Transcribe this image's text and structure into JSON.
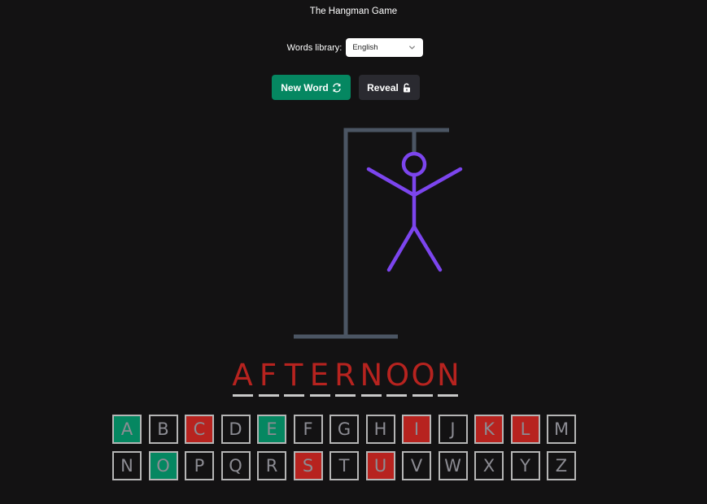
{
  "app": {
    "title": "The Hangman Game"
  },
  "library": {
    "label": "Words library:",
    "selected": "English"
  },
  "buttons": {
    "new_word": "New Word",
    "reveal": "Reveal"
  },
  "colors": {
    "background": "#131213",
    "correct": "#058761",
    "wrong": "#b7231f",
    "gallows": "#4b5563",
    "figure": "#7c45ee",
    "revealed_letter": "#b7231f"
  },
  "word": {
    "letters": [
      "A",
      "F",
      "T",
      "E",
      "R",
      "N",
      "O",
      "O",
      "N"
    ]
  },
  "keyboard": {
    "rows": [
      [
        {
          "letter": "A",
          "state": "correct"
        },
        {
          "letter": "B",
          "state": "unused"
        },
        {
          "letter": "C",
          "state": "wrong"
        },
        {
          "letter": "D",
          "state": "unused"
        },
        {
          "letter": "E",
          "state": "correct"
        },
        {
          "letter": "F",
          "state": "unused"
        },
        {
          "letter": "G",
          "state": "unused"
        },
        {
          "letter": "H",
          "state": "unused"
        },
        {
          "letter": "I",
          "state": "wrong"
        },
        {
          "letter": "J",
          "state": "unused"
        },
        {
          "letter": "K",
          "state": "wrong"
        },
        {
          "letter": "L",
          "state": "wrong"
        },
        {
          "letter": "M",
          "state": "unused"
        }
      ],
      [
        {
          "letter": "N",
          "state": "unused"
        },
        {
          "letter": "O",
          "state": "correct"
        },
        {
          "letter": "P",
          "state": "unused"
        },
        {
          "letter": "Q",
          "state": "unused"
        },
        {
          "letter": "R",
          "state": "unused"
        },
        {
          "letter": "S",
          "state": "wrong"
        },
        {
          "letter": "T",
          "state": "unused"
        },
        {
          "letter": "U",
          "state": "wrong"
        },
        {
          "letter": "V",
          "state": "unused"
        },
        {
          "letter": "W",
          "state": "unused"
        },
        {
          "letter": "X",
          "state": "unused"
        },
        {
          "letter": "Y",
          "state": "unused"
        },
        {
          "letter": "Z",
          "state": "unused"
        }
      ]
    ]
  },
  "icons": {
    "new_word": "refresh-icon",
    "reveal": "unlock-icon",
    "select": "chevron-down-icon"
  }
}
